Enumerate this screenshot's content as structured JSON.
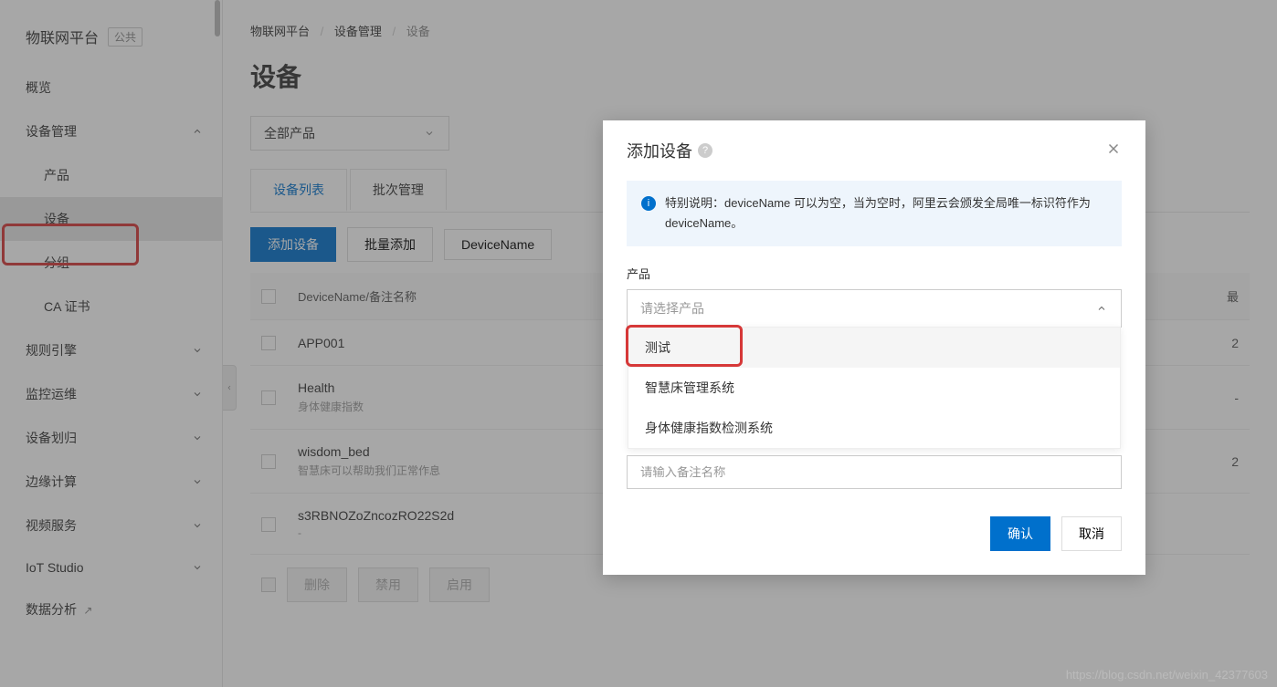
{
  "brand": {
    "title": "物联网平台",
    "tag": "公共"
  },
  "sidebar": {
    "items": [
      {
        "label": "概览"
      },
      {
        "label": "设备管理",
        "expanded": true
      },
      {
        "label": "产品",
        "sub": true
      },
      {
        "label": "设备",
        "sub": true,
        "active": true
      },
      {
        "label": "分组",
        "sub": true
      },
      {
        "label": "CA 证书",
        "sub": true
      },
      {
        "label": "规则引擎"
      },
      {
        "label": "监控运维"
      },
      {
        "label": "设备划归"
      },
      {
        "label": "边缘计算"
      },
      {
        "label": "视频服务"
      },
      {
        "label": "IoT Studio"
      },
      {
        "label": "数据分析",
        "ext": true
      }
    ]
  },
  "breadcrumb": {
    "a": "物联网平台",
    "b": "设备管理",
    "c": "设备"
  },
  "page_title": "设备",
  "filter": {
    "all_products": "全部产品"
  },
  "tabs": {
    "list": "设备列表",
    "batch": "批次管理"
  },
  "toolbar": {
    "add": "添加设备",
    "batch_add": "批量添加",
    "search_label": "DeviceName"
  },
  "table": {
    "header": {
      "name": "DeviceName/备注名称",
      "last": "最"
    },
    "rows": [
      {
        "name": "APP001",
        "note": "",
        "r": "2"
      },
      {
        "name": "Health",
        "note": "身体健康指数",
        "r": "-"
      },
      {
        "name": "wisdom_bed",
        "note": "智慧床可以帮助我们正常作息",
        "r": "2"
      },
      {
        "name": "s3RBNOZoZncozRO22S2d",
        "note": "-",
        "r": ""
      }
    ]
  },
  "footer": {
    "delete": "删除",
    "disable": "禁用",
    "enable": "启用"
  },
  "modal": {
    "title": "添加设备",
    "info": "特别说明：deviceName 可以为空，当为空时，阿里云会颁发全局唯一标识符作为 deviceName。",
    "product_label": "产品",
    "product_placeholder": "请选择产品",
    "options": [
      "测试",
      "智慧床管理系统",
      "身体健康指数检测系统"
    ],
    "note_placeholder": "请输入备注名称",
    "confirm": "确认",
    "cancel": "取消"
  },
  "watermark": "https://blog.csdn.net/weixin_42377603"
}
